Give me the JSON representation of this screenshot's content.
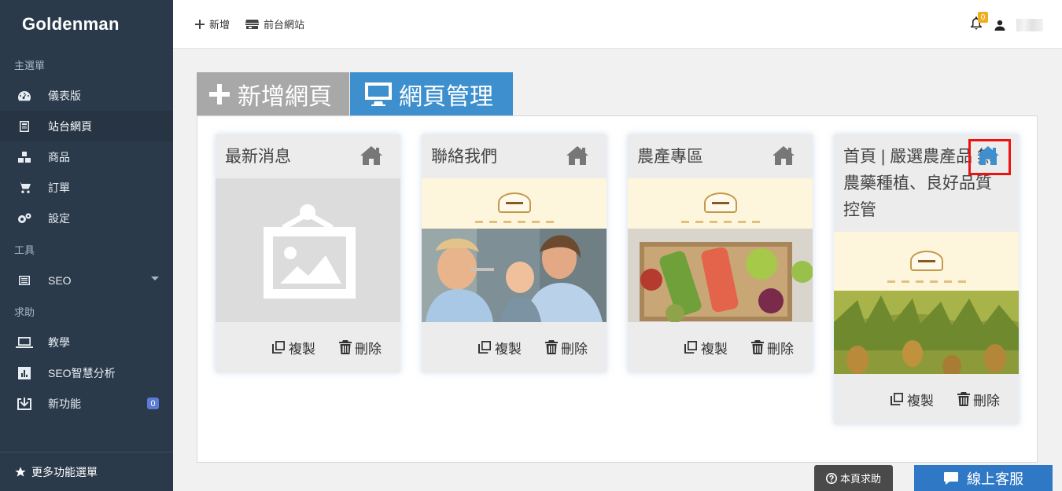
{
  "sidebar": {
    "brand": "Goldenman",
    "sections": {
      "main": "主選單",
      "tools": "工具",
      "help": "求助"
    },
    "items": {
      "dashboard": "儀表版",
      "site_pages": "站台網頁",
      "products": "商品",
      "orders": "訂單",
      "settings": "設定",
      "seo": "SEO",
      "tutorial": "教學",
      "seo_analysis": "SEO智慧分析",
      "new_features": "新功能",
      "new_features_badge": "0"
    },
    "more_menu": "更多功能選單"
  },
  "topbar": {
    "add": "新增",
    "frontend": "前台網站",
    "notifications_count": "0"
  },
  "tabs": {
    "add_page": "新增網頁",
    "manage_pages": "網頁管理"
  },
  "cards": [
    {
      "title": "最新消息",
      "copy": "複製",
      "delete": "刪除"
    },
    {
      "title": "聯絡我們",
      "copy": "複製",
      "delete": "刪除"
    },
    {
      "title": "農產專區",
      "copy": "複製",
      "delete": "刪除"
    },
    {
      "title": "首頁 | 嚴選農產品 無農藥種植、良好品質控管",
      "copy": "複製",
      "delete": "刪除"
    }
  ],
  "footer": {
    "help": "本頁求助",
    "chat": "線上客服"
  },
  "colors": {
    "sidebar": "#2b3a4a",
    "accent_blue": "#3d8fce",
    "home_active": "#3d8fce",
    "highlight": "#ee1111"
  }
}
